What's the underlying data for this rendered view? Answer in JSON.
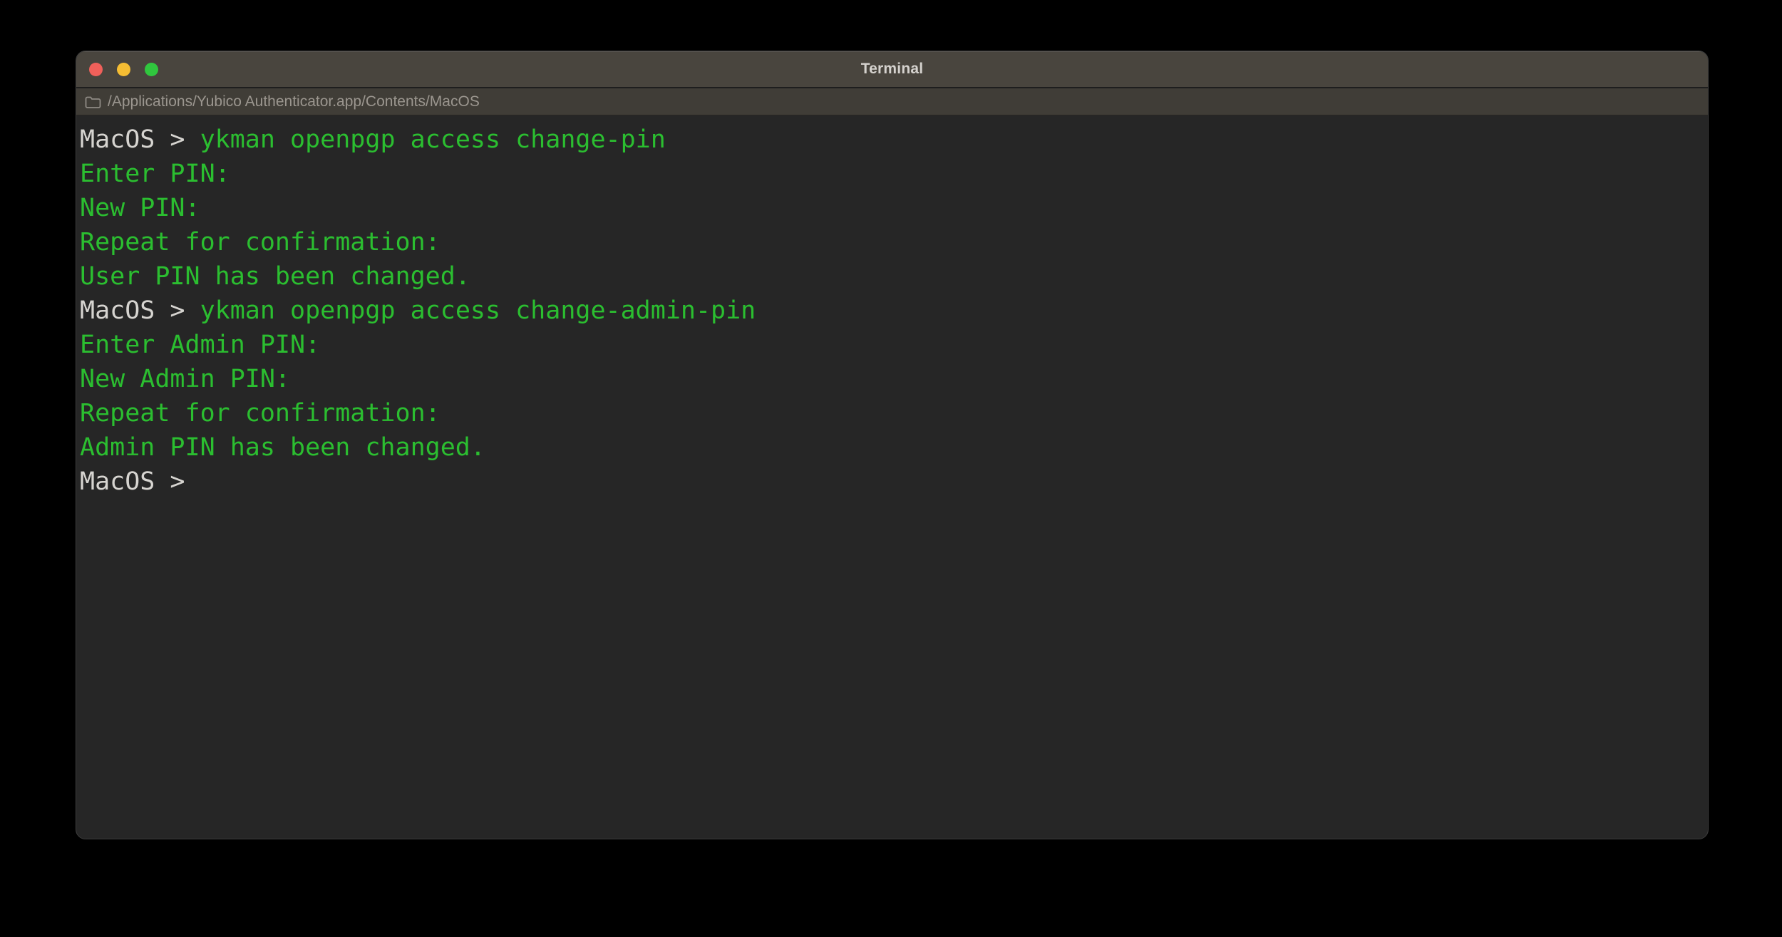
{
  "window": {
    "title": "Terminal"
  },
  "traffic_lights": {
    "close_color": "#f0605a",
    "minimize_color": "#f5bd33",
    "maximize_color": "#30c73e"
  },
  "pathbar": {
    "path": "/Applications/Yubico Authenticator.app/Contents/MacOS"
  },
  "colors": {
    "terminal_background": "#262626",
    "titlebar_background": "#49453e",
    "output_green": "#2bbe30",
    "prompt_gray": "#d6d4d0"
  },
  "terminal": {
    "prompt": "MacOS >",
    "lines": [
      {
        "type": "command",
        "prompt": "MacOS >",
        "command": "ykman openpgp access change-pin"
      },
      {
        "type": "output",
        "text": "Enter PIN:"
      },
      {
        "type": "output",
        "text": "New PIN:"
      },
      {
        "type": "output",
        "text": "Repeat for confirmation:"
      },
      {
        "type": "output",
        "text": "User PIN has been changed."
      },
      {
        "type": "command",
        "prompt": "MacOS >",
        "command": "ykman openpgp access change-admin-pin"
      },
      {
        "type": "output",
        "text": "Enter Admin PIN:"
      },
      {
        "type": "output",
        "text": "New Admin PIN:"
      },
      {
        "type": "output",
        "text": "Repeat for confirmation:"
      },
      {
        "type": "output",
        "text": "Admin PIN has been changed."
      },
      {
        "type": "prompt",
        "prompt": "MacOS >"
      }
    ]
  }
}
